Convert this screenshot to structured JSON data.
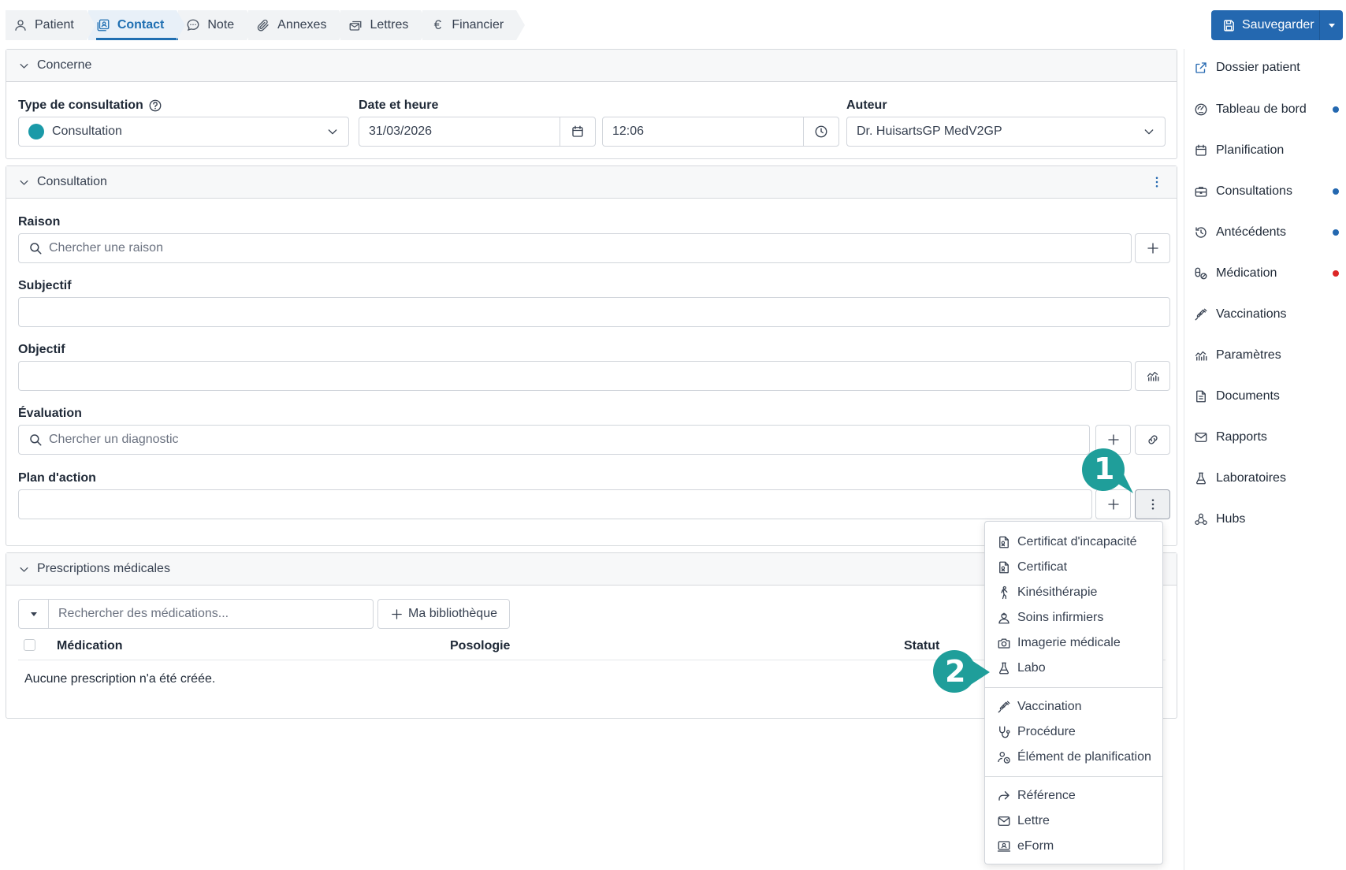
{
  "tabs": [
    {
      "label": "Patient",
      "icon": "user-icon"
    },
    {
      "label": "Contact",
      "icon": "contact-icon",
      "active": true
    },
    {
      "label": "Note",
      "icon": "chat-icon"
    },
    {
      "label": "Annexes",
      "icon": "paperclip-icon"
    },
    {
      "label": "Lettres",
      "icon": "letters-icon"
    },
    {
      "label": "Financier",
      "icon": "euro-icon"
    }
  ],
  "save_button": {
    "label": "Sauvegarder"
  },
  "concerne": {
    "title": "Concerne",
    "type_label": "Type de consultation",
    "type_value": "Consultation",
    "type_color": "#1a9aa8",
    "date_label": "Date et heure",
    "date_value": "31/03/2026",
    "time_value": "12:06",
    "author_label": "Auteur",
    "author_value": "Dr. HuisartsGP MedV2GP"
  },
  "consultation": {
    "title": "Consultation",
    "raison_label": "Raison",
    "raison_placeholder": "Chercher une raison",
    "subjectif_label": "Subjectif",
    "objectif_label": "Objectif",
    "evaluation_label": "Évaluation",
    "evaluation_placeholder": "Chercher un diagnostic",
    "plan_label": "Plan d'action"
  },
  "prescriptions": {
    "title": "Prescriptions médicales",
    "search_placeholder": "Rechercher des médications...",
    "library_label": "Ma bibliothèque",
    "columns": [
      "Médication",
      "Posologie",
      "Statut"
    ],
    "empty_text": "Aucune prescription n'a été créée."
  },
  "sidebar": {
    "items": [
      {
        "label": "Dossier patient",
        "icon": "external-link-icon",
        "dot": null
      },
      {
        "label": "Tableau de bord",
        "icon": "dashboard-icon",
        "dot": "#2468b0"
      },
      {
        "label": "Planification",
        "icon": "calendar-icon",
        "dot": null
      },
      {
        "label": "Consultations",
        "icon": "briefcase-icon",
        "dot": "#2468b0"
      },
      {
        "label": "Antécédents",
        "icon": "history-icon",
        "dot": "#2468b0"
      },
      {
        "label": "Médication",
        "icon": "pills-icon",
        "dot": "#dc2626"
      },
      {
        "label": "Vaccinations",
        "icon": "syringe-icon",
        "dot": null
      },
      {
        "label": "Paramètres",
        "icon": "chart-icon",
        "dot": null
      },
      {
        "label": "Documents",
        "icon": "document-icon",
        "dot": null
      },
      {
        "label": "Rapports",
        "icon": "mail-icon",
        "dot": null
      },
      {
        "label": "Laboratoires",
        "icon": "flask-icon",
        "dot": null
      },
      {
        "label": "Hubs",
        "icon": "hubs-icon",
        "dot": null
      }
    ]
  },
  "menu": {
    "items": [
      {
        "label": "Certificat d'incapacité",
        "icon": "certificate-icon"
      },
      {
        "label": "Certificat",
        "icon": "certificate-icon"
      },
      {
        "label": "Kinésithérapie",
        "icon": "walking-icon"
      },
      {
        "label": "Soins infirmiers",
        "icon": "nurse-icon"
      },
      {
        "label": "Imagerie médicale",
        "icon": "camera-icon"
      },
      {
        "label": "Labo",
        "icon": "flask-icon"
      },
      {
        "label": "Vaccination",
        "icon": "syringe-icon"
      },
      {
        "label": "Procédure",
        "icon": "stethoscope-icon"
      },
      {
        "label": "Élément de planification",
        "icon": "person-clock-icon"
      },
      {
        "label": "Référence",
        "icon": "share-icon"
      },
      {
        "label": "Lettre",
        "icon": "mail-icon"
      },
      {
        "label": "eForm",
        "icon": "eform-icon"
      }
    ]
  },
  "callouts": [
    {
      "number": "1",
      "color": "#1f9e9a"
    },
    {
      "number": "2",
      "color": "#1f9e9a"
    }
  ]
}
